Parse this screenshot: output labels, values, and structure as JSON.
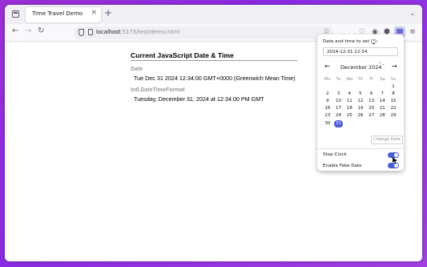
{
  "browser": {
    "tab_title": "Time Travel Demo",
    "tab_close": "×",
    "new_tab": "+",
    "tab_list": "⌄",
    "url_host": "localhost",
    "url_path": ":5173/test/demo.html",
    "back": "←",
    "forward": "→",
    "reload": "↻",
    "star": "☆",
    "pocket": "♡",
    "account": "◉",
    "extensions": "⬢",
    "menu": "≡"
  },
  "page": {
    "title": "Current JavaScript Date & Time",
    "sections": [
      {
        "label": "Date",
        "value": "Tue Dec 31 2024 12:34:00 GMT+0000 (Greenwich Mean Time)"
      },
      {
        "label": "Intl.DateTimeFormat",
        "value": "Tuesday, December 31, 2024 at 12:34:00 PM GMT"
      }
    ]
  },
  "popup": {
    "label_prefix": "Date and time to set (",
    "label_link": "?",
    "label_suffix": "):",
    "input_value": "2024-12-31 12:34",
    "calendar": {
      "prev": "←",
      "next": "→",
      "month_label": "December 2024",
      "spin": "⌃⌄",
      "weekdays": [
        "Mo",
        "Tu",
        "We",
        "Th",
        "Fr",
        "Sa",
        "Su"
      ],
      "weeks": [
        [
          "",
          "",
          "",
          "",
          "",
          "",
          "1"
        ],
        [
          "2",
          "3",
          "4",
          "5",
          "6",
          "7",
          "8"
        ],
        [
          "9",
          "10",
          "11",
          "12",
          "13",
          "14",
          "15"
        ],
        [
          "16",
          "17",
          "18",
          "19",
          "20",
          "21",
          "22"
        ],
        [
          "23",
          "24",
          "25",
          "26",
          "27",
          "28",
          "29"
        ],
        [
          "30",
          "31",
          "",
          "",
          "",
          "",
          ""
        ]
      ],
      "selected_day": "31"
    },
    "change_button": "Change Date",
    "stop_clock_label": "Stop Clock",
    "stop_clock_on": true,
    "fake_date_label": "Enable Fake Date",
    "fake_date_on": true,
    "accent_color": "#4a5cd6"
  }
}
